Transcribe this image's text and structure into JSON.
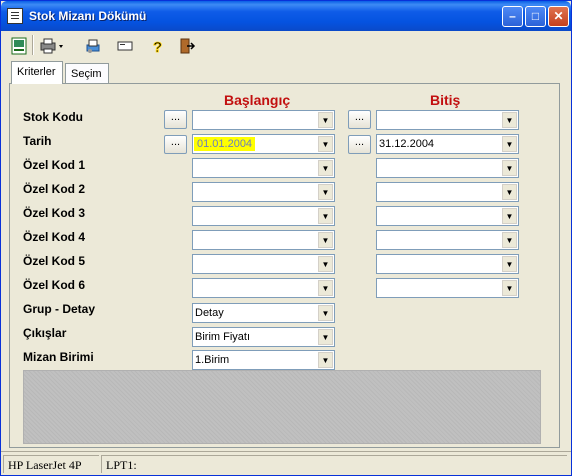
{
  "window": {
    "title": "Stok Mizanı Dökümü"
  },
  "tabs": [
    {
      "label": "Kriterler"
    },
    {
      "label": "Seçim"
    }
  ],
  "headers": {
    "start": "Başlangıç",
    "end": "Bitiş"
  },
  "rows": [
    {
      "label": "Stok Kodu",
      "start_value": "",
      "end_value": ""
    },
    {
      "label": "Tarih",
      "start_value": "01.01.2004",
      "end_value": "31.12.2004"
    },
    {
      "label": "Özel Kod 1",
      "start_value": "",
      "end_value": ""
    },
    {
      "label": "Özel Kod 2",
      "start_value": "",
      "end_value": ""
    },
    {
      "label": "Özel Kod 3",
      "start_value": "",
      "end_value": ""
    },
    {
      "label": "Özel Kod 4",
      "start_value": "",
      "end_value": ""
    },
    {
      "label": "Özel Kod 5",
      "start_value": "",
      "end_value": ""
    },
    {
      "label": "Özel Kod 6",
      "start_value": "",
      "end_value": ""
    }
  ],
  "options": [
    {
      "label": "Grup - Detay",
      "value": "Detay"
    },
    {
      "label": "Çıkışlar",
      "value": "Birim Fiyatı"
    },
    {
      "label": "Mizan Birimi",
      "value": "1.Birim"
    }
  ],
  "status": {
    "printer": "HP LaserJet 4P",
    "port": "LPT1:"
  },
  "ellipsis": "..."
}
